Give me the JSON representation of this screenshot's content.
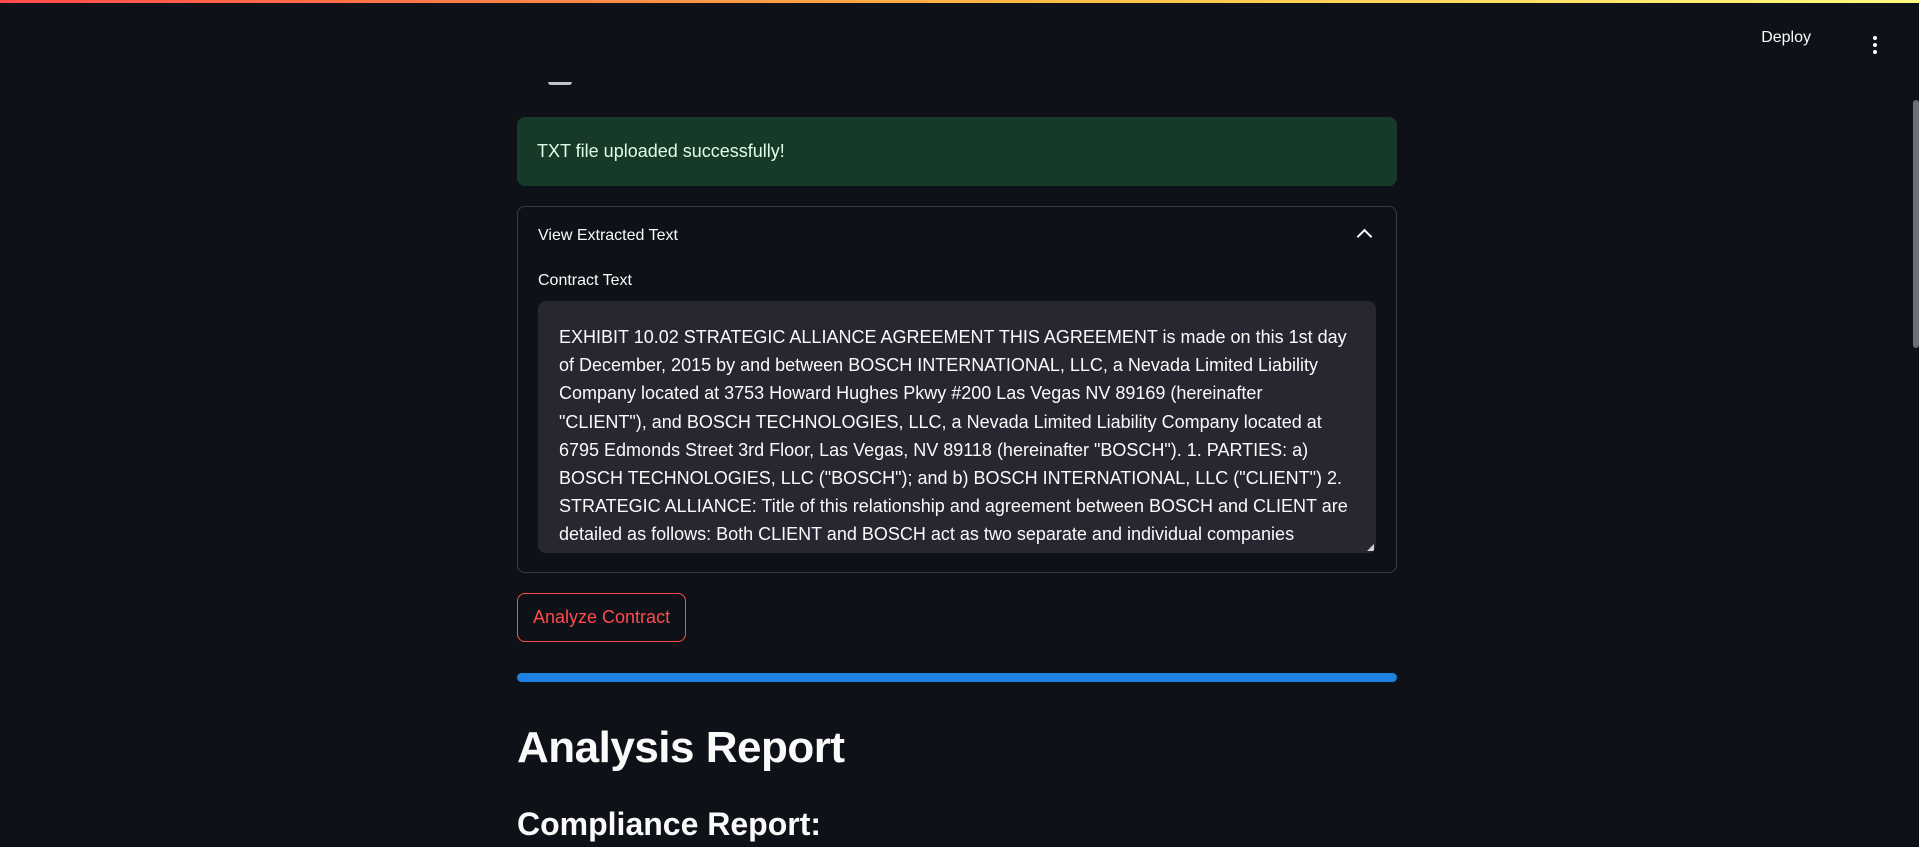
{
  "header": {
    "deploy_label": "Deploy",
    "menu_icon": "more-vertical-icon"
  },
  "alert": {
    "message": "TXT file uploaded successfully!",
    "color": "#173928"
  },
  "expander": {
    "title": "View Extracted Text",
    "expanded": true,
    "textarea": {
      "label": "Contract Text",
      "value": "EXHIBIT 10.02 STRATEGIC ALLIANCE AGREEMENT THIS AGREEMENT is made on this 1st day of December, 2015 by and between BOSCH INTERNATIONAL, LLC, a Nevada Limited Liability Company located at 3753 Howard Hughes Pkwy #200 Las Vegas NV 89169 (hereinafter \"CLIENT\"), and BOSCH TECHNOLOGIES, LLC, a Nevada Limited Liability Company located at 6795 Edmonds Street 3rd Floor, Las Vegas, NV 89118 (hereinafter \"BOSCH\"). 1. PARTIES: a) BOSCH TECHNOLOGIES, LLC (\"BOSCH\"); and b) BOSCH INTERNATIONAL, LLC (\"CLIENT\") 2. STRATEGIC ALLIANCE: Title of this relationship and agreement between BOSCH and CLIENT are detailed as follows: Both CLIENT and BOSCH act as two separate and individual companies"
    }
  },
  "actions": {
    "analyze_label": "Analyze Contract",
    "accent_color": "#ff4b4b"
  },
  "progress": {
    "value": 1.0,
    "color": "#1c83e1"
  },
  "report": {
    "title": "Analysis Report",
    "compliance_heading": "Compliance Report:"
  }
}
